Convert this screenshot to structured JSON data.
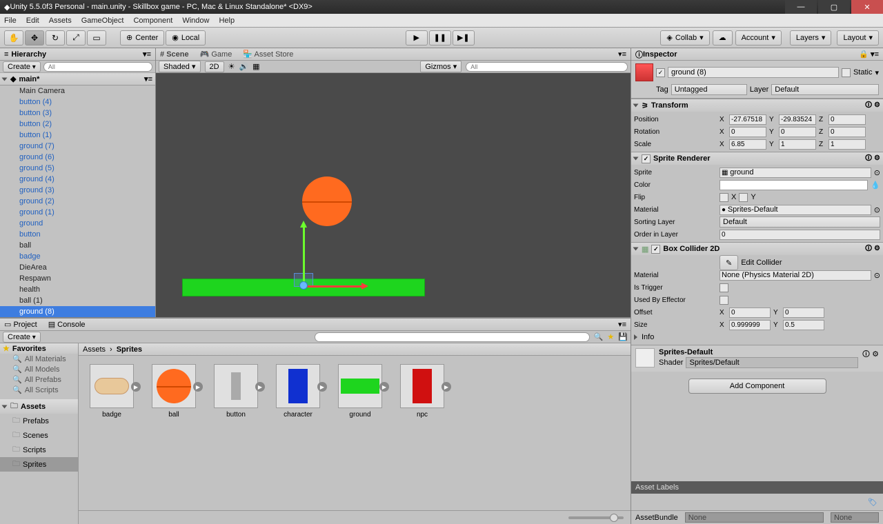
{
  "window": {
    "title": "Unity 5.5.0f3 Personal - main.unity - Skillbox game - PC, Mac & Linux Standalone* <DX9>"
  },
  "menu": [
    "File",
    "Edit",
    "Assets",
    "GameObject",
    "Component",
    "Window",
    "Help"
  ],
  "toolbar": {
    "center": "Center",
    "local": "Local",
    "collab": "Collab",
    "account": "Account",
    "layers": "Layers",
    "layout": "Layout"
  },
  "hierarchy": {
    "title": "Hierarchy",
    "create": "Create",
    "search_placeholder": "All",
    "scene": "main*",
    "items": [
      {
        "label": "Main Camera",
        "link": false
      },
      {
        "label": "button (4)",
        "link": true
      },
      {
        "label": "button (3)",
        "link": true
      },
      {
        "label": "button (2)",
        "link": true
      },
      {
        "label": "button (1)",
        "link": true
      },
      {
        "label": "ground (7)",
        "link": true
      },
      {
        "label": "ground (6)",
        "link": true
      },
      {
        "label": "ground (5)",
        "link": true
      },
      {
        "label": "ground (4)",
        "link": true
      },
      {
        "label": "ground (3)",
        "link": true
      },
      {
        "label": "ground (2)",
        "link": true
      },
      {
        "label": "ground (1)",
        "link": true
      },
      {
        "label": "ground",
        "link": true
      },
      {
        "label": "button",
        "link": true
      },
      {
        "label": "ball",
        "link": false
      },
      {
        "label": "badge",
        "link": true
      },
      {
        "label": "DieArea",
        "link": false
      },
      {
        "label": "Respawn",
        "link": false
      },
      {
        "label": "health",
        "link": false
      },
      {
        "label": "ball (1)",
        "link": false
      },
      {
        "label": "ground (8)",
        "link": true,
        "selected": true
      }
    ]
  },
  "sceneTabs": {
    "scene": "Scene",
    "game": "Game",
    "asset_store": "Asset Store"
  },
  "sceneToolbar": {
    "shaded": "Shaded",
    "mode2d": "2D",
    "gizmos": "Gizmos",
    "search_placeholder": "All"
  },
  "project": {
    "title": "Project",
    "console": "Console",
    "create": "Create",
    "favorites": "Favorites",
    "fav_items": [
      "All Materials",
      "All Models",
      "All Prefabs",
      "All Scripts"
    ],
    "assets": "Assets",
    "folders": [
      "Prefabs",
      "Scenes",
      "Scripts",
      "Sprites"
    ],
    "selected_folder": "Sprites",
    "breadcrumb": [
      "Assets",
      "Sprites"
    ],
    "sprites": [
      "badge",
      "ball",
      "button",
      "character",
      "ground",
      "npc"
    ]
  },
  "inspector": {
    "title": "Inspector",
    "object_name": "ground (8)",
    "static": "Static",
    "tag_label": "Tag",
    "tag_value": "Untagged",
    "layer_label": "Layer",
    "layer_value": "Default",
    "transform": {
      "title": "Transform",
      "position": {
        "x": "-27.67518",
        "y": "-29.83524",
        "z": "0"
      },
      "rotation": {
        "x": "0",
        "y": "0",
        "z": "0"
      },
      "scale": {
        "x": "6.85",
        "y": "1",
        "z": "1"
      },
      "pos_label": "Position",
      "rot_label": "Rotation",
      "scale_label": "Scale"
    },
    "sprite_renderer": {
      "title": "Sprite Renderer",
      "sprite_label": "Sprite",
      "sprite_value": "ground",
      "color_label": "Color",
      "flip_label": "Flip",
      "flip_x": "X",
      "flip_y": "Y",
      "material_label": "Material",
      "material_value": "Sprites-Default",
      "sorting_layer_label": "Sorting Layer",
      "sorting_layer_value": "Default",
      "order_label": "Order in Layer",
      "order_value": "0"
    },
    "box_collider": {
      "title": "Box Collider 2D",
      "edit_collider": "Edit Collider",
      "material_label": "Material",
      "material_value": "None (Physics Material 2D)",
      "is_trigger_label": "Is Trigger",
      "used_by_effector_label": "Used By Effector",
      "offset_label": "Offset",
      "offset": {
        "x": "0",
        "y": "0"
      },
      "size_label": "Size",
      "size": {
        "x": "0.999999",
        "y": "0.5"
      }
    },
    "info": "Info",
    "material_preview": {
      "name": "Sprites-Default",
      "shader_label": "Shader",
      "shader_value": "Sprites/Default"
    },
    "add_component": "Add Component",
    "asset_labels": "Asset Labels",
    "assetbundle": "AssetBundle",
    "none": "None"
  }
}
